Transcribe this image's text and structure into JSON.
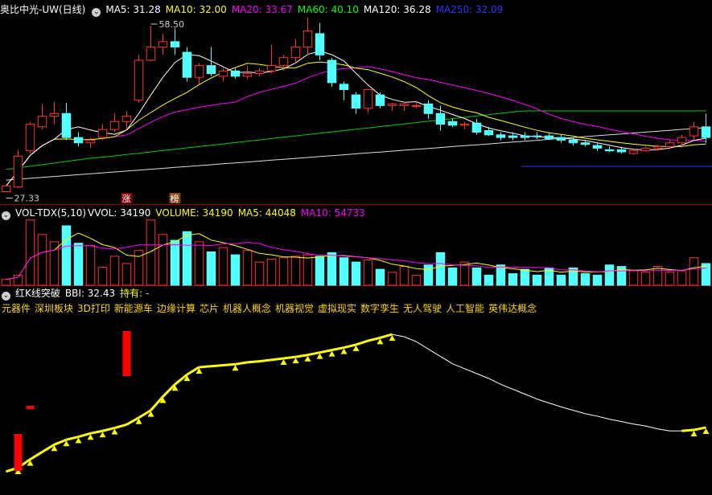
{
  "chart_data": [
    {
      "type": "candlestick",
      "title": "奥比中光-UW(日线)",
      "indicators": [
        {
          "label": "MA5: 31.28",
          "color": "#ffffff"
        },
        {
          "label": "MA10: 32.00",
          "color": "#ffff00"
        },
        {
          "label": "MA20: 33.67",
          "color": "#ff00ff"
        },
        {
          "label": "MA60: 40.10",
          "color": "#00ff00"
        },
        {
          "label": "MA120: 36.28",
          "color": "#ffffff"
        },
        {
          "label": "MA250: 32.09",
          "color": "#3333ff"
        }
      ],
      "annotations": {
        "high": "58.50",
        "low": "27.33",
        "tags": [
          "涨",
          "榜"
        ]
      },
      "candles": [
        [
          27.33,
          28.6,
          27.33,
          28.4
        ],
        [
          28.2,
          35.2,
          28.0,
          34.0
        ],
        [
          35.0,
          40.5,
          34.5,
          40.0
        ],
        [
          39.5,
          43.8,
          39.0,
          41.5
        ],
        [
          41.5,
          44.2,
          40.0,
          42.0
        ],
        [
          42.0,
          44.0,
          37.0,
          37.5
        ],
        [
          37.5,
          38.5,
          35.8,
          36.5
        ],
        [
          36.5,
          37.5,
          35.5,
          37.0
        ],
        [
          37.5,
          40.0,
          37.0,
          39.0
        ],
        [
          39.0,
          42.0,
          38.5,
          40.5
        ],
        [
          40.5,
          42.5,
          39.0,
          41.5
        ],
        [
          44.5,
          53.0,
          44.0,
          52.0
        ],
        [
          52.0,
          58.5,
          51.8,
          54.5
        ],
        [
          54.5,
          57.0,
          53.0,
          55.5
        ],
        [
          55.5,
          58.0,
          53.0,
          54.5
        ],
        [
          53.5,
          54.5,
          48.0,
          48.8
        ],
        [
          48.8,
          51.5,
          47.5,
          51.0
        ],
        [
          51.0,
          54.5,
          49.0,
          49.5
        ],
        [
          49.0,
          50.5,
          48.0,
          50.0
        ],
        [
          50.0,
          50.5,
          48.5,
          49.0
        ],
        [
          49.0,
          51.0,
          48.5,
          49.5
        ],
        [
          49.5,
          50.5,
          49.0,
          50.0
        ],
        [
          50.0,
          55.0,
          49.5,
          51.0
        ],
        [
          51.0,
          53.0,
          50.0,
          52.5
        ],
        [
          52.5,
          56.0,
          51.5,
          54.5
        ],
        [
          54.5,
          60.0,
          53.0,
          57.5
        ],
        [
          57.0,
          59.0,
          52.0,
          53.0
        ],
        [
          52.0,
          52.5,
          47.0,
          47.8
        ],
        [
          47.5,
          48.0,
          44.5,
          46.5
        ],
        [
          45.5,
          46.0,
          42.0,
          43.0
        ],
        [
          43.0,
          46.5,
          42.0,
          46.5
        ],
        [
          45.5,
          46.0,
          43.0,
          43.5
        ],
        [
          43.5,
          44.0,
          42.5,
          43.8
        ],
        [
          43.5,
          44.2,
          42.5,
          43.8
        ],
        [
          43.5,
          44.5,
          43.0,
          43.5
        ],
        [
          43.8,
          44.5,
          41.0,
          42.0
        ],
        [
          42.0,
          43.5,
          38.8,
          40.0
        ],
        [
          40.5,
          41.0,
          39.5,
          39.8
        ],
        [
          39.8,
          40.5,
          39.0,
          40.0
        ],
        [
          40.2,
          41.0,
          38.0,
          38.5
        ],
        [
          38.8,
          39.5,
          37.8,
          38.0
        ],
        [
          38.0,
          38.5,
          37.0,
          37.5
        ],
        [
          37.8,
          38.5,
          37.0,
          37.5
        ],
        [
          37.8,
          38.5,
          37.0,
          37.5
        ],
        [
          37.8,
          38.5,
          37.2,
          37.7
        ],
        [
          37.8,
          38.5,
          37.0,
          37.3
        ],
        [
          37.5,
          38.0,
          36.5,
          37.0
        ],
        [
          37.0,
          37.5,
          36.0,
          36.5
        ],
        [
          36.5,
          37.0,
          35.8,
          36.2
        ],
        [
          36.0,
          36.5,
          35.0,
          35.5
        ],
        [
          35.2,
          35.8,
          34.8,
          35.0
        ],
        [
          35.2,
          35.8,
          34.5,
          34.8
        ],
        [
          34.5,
          35.5,
          34.2,
          35.0
        ],
        [
          35.0,
          35.8,
          34.8,
          35.5
        ],
        [
          35.5,
          36.2,
          35.0,
          35.8
        ],
        [
          35.8,
          37.0,
          35.5,
          36.5
        ],
        [
          36.5,
          38.0,
          36.0,
          37.5
        ],
        [
          37.8,
          40.5,
          37.0,
          39.5
        ],
        [
          39.5,
          42.0,
          36.5,
          37.5
        ]
      ]
    },
    {
      "type": "bar",
      "title": "VOL-TDX(5,10)",
      "indicators": [
        {
          "label": "VVOL: 34190",
          "color": "#ffffff"
        },
        {
          "label": "VOLUME: 34190",
          "color": "#ffff00"
        },
        {
          "label": "MA5: 44048",
          "color": "#ffff00"
        },
        {
          "label": "MA10: 54733",
          "color": "#ff00ff"
        }
      ],
      "values": [
        8,
        14,
        90,
        70,
        60,
        82,
        58,
        55,
        25,
        40,
        30,
        48,
        90,
        70,
        62,
        74,
        60,
        46,
        52,
        42,
        48,
        32,
        36,
        38,
        40,
        42,
        40,
        45,
        38,
        32,
        35,
        22,
        18,
        26,
        14,
        28,
        45,
        24,
        32,
        24,
        14,
        28,
        16,
        22,
        14,
        24,
        14,
        24,
        16,
        14,
        28,
        26,
        20,
        18,
        26,
        18,
        20,
        38,
        30
      ]
    },
    {
      "type": "line",
      "title": "红K线突破",
      "indicators": [
        {
          "label": "BBI: 32.43",
          "color": "#ffffff"
        },
        {
          "label": "持有: -",
          "color": "#ffff00"
        }
      ],
      "concepts": [
        "元器件",
        "深圳板块",
        "3D打印",
        "新能源车",
        "边缘计算",
        "芯片",
        "机器人概念",
        "机器视觉",
        "虚拟现实",
        "数字孪生",
        "无人驾驶",
        "人工智能",
        "英伟达概念"
      ],
      "series": [
        {
          "values": [
            28.5,
            29.3,
            31.0,
            32.5,
            34.0,
            35.0,
            35.6,
            36.3,
            36.8,
            37.4,
            38.1,
            39.5,
            41.0,
            43.8,
            46.3,
            48.3,
            49.8,
            50.0,
            50.2,
            50.4,
            50.8,
            51.0,
            51.3,
            51.6,
            51.9,
            52.3,
            52.8,
            53.3,
            53.8,
            54.4,
            55.2,
            55.8,
            56.5,
            56.0,
            55.0,
            53.5,
            52.0,
            50.5,
            49.5,
            48.5,
            47.5,
            46.3,
            45.3,
            44.3,
            43.3,
            42.5,
            41.7,
            41.0,
            40.3,
            39.8,
            39.2,
            38.7,
            38.2,
            37.8,
            37.2,
            36.8,
            36.8,
            37.0,
            37.5
          ]
        }
      ]
    }
  ]
}
